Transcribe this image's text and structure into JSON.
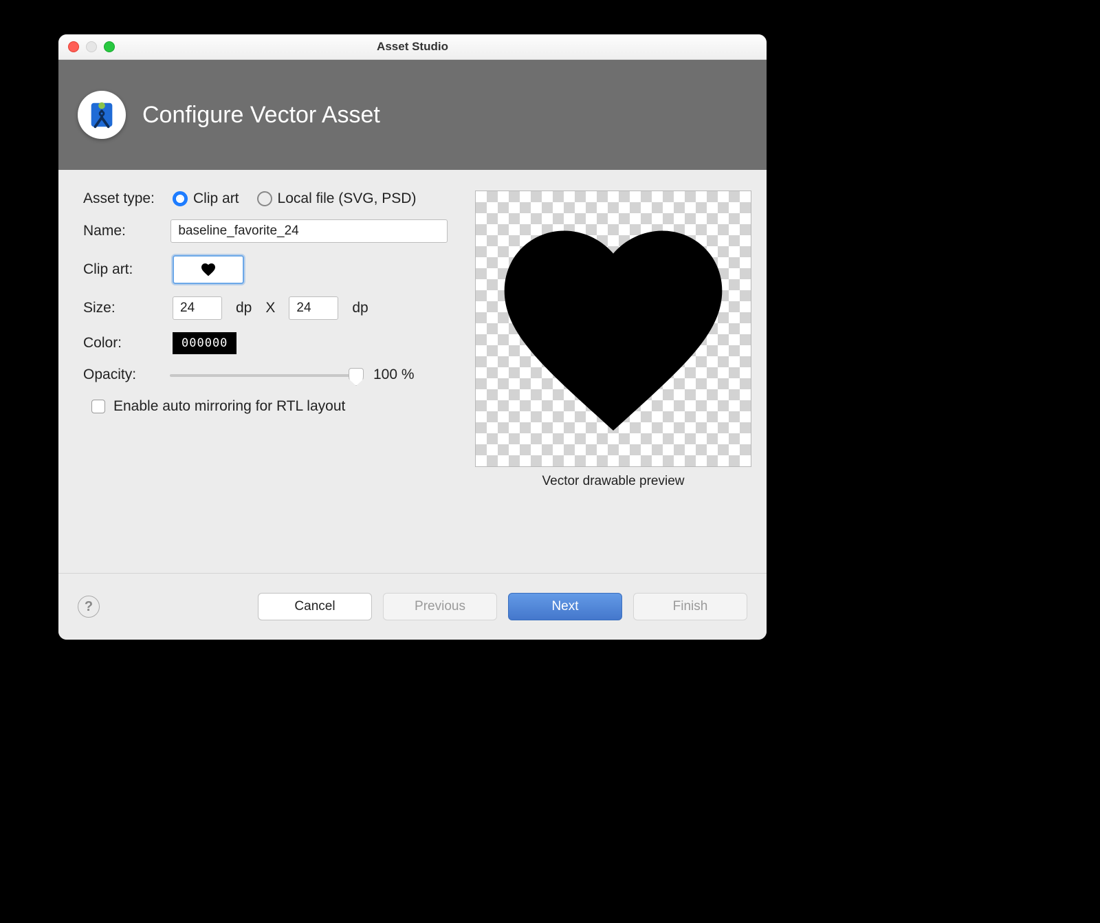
{
  "window": {
    "title": "Asset Studio"
  },
  "banner": {
    "title": "Configure Vector Asset",
    "icon": "android-studio-icon"
  },
  "form": {
    "asset_type": {
      "label": "Asset type:",
      "options": {
        "clip_art": "Clip art",
        "local_file": "Local file (SVG, PSD)"
      },
      "selected": "clip_art"
    },
    "name": {
      "label": "Name:",
      "value": "baseline_favorite_24"
    },
    "clip_art": {
      "label": "Clip art:",
      "icon": "heart-icon"
    },
    "size": {
      "label": "Size:",
      "width": "24",
      "height": "24",
      "unit": "dp",
      "sep": "X"
    },
    "color": {
      "label": "Color:",
      "hex": "000000"
    },
    "opacity": {
      "label": "Opacity:",
      "value": 100,
      "display": "100 %"
    },
    "rtl": {
      "label": "Enable auto mirroring for RTL layout",
      "checked": false
    }
  },
  "preview": {
    "caption": "Vector drawable preview",
    "icon": "heart-icon"
  },
  "footer": {
    "help": "?",
    "cancel": "Cancel",
    "previous": "Previous",
    "next": "Next",
    "finish": "Finish"
  }
}
